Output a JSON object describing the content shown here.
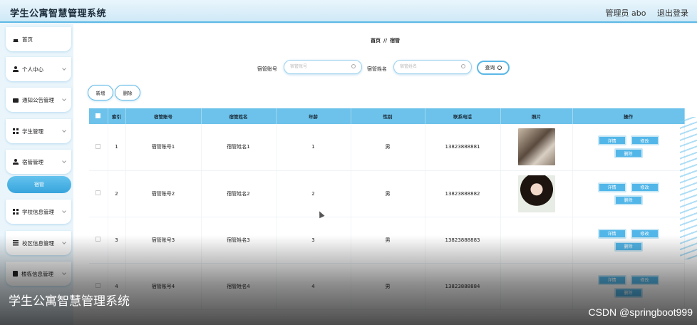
{
  "header": {
    "title": "学生公寓智慧管理系统",
    "user": "管理员 abo",
    "logout": "退出登录"
  },
  "sidebar": {
    "items": [
      {
        "label": "首页",
        "icon": "home-icon"
      },
      {
        "label": "个人中心",
        "icon": "user-icon"
      },
      {
        "label": "通知公告管理",
        "icon": "message-icon"
      },
      {
        "label": "学生管理",
        "icon": "grid-icon"
      },
      {
        "label": "宿管管理",
        "icon": "user-icon"
      },
      {
        "label": "学校信息管理",
        "icon": "grid-icon"
      },
      {
        "label": "校区信息管理",
        "icon": "list-icon"
      },
      {
        "label": "楼栋信息管理",
        "icon": "book-icon"
      }
    ],
    "sub_active": "宿管"
  },
  "breadcrumb": {
    "home": "首页",
    "sep": "//",
    "current": "宿管"
  },
  "search": {
    "account_label": "宿管账号",
    "account_placeholder": "宿管账号",
    "name_label": "宿管姓名",
    "name_placeholder": "宿管姓名",
    "query_label": "查询"
  },
  "actions": {
    "add": "新增",
    "delete": "删除"
  },
  "table": {
    "columns": [
      "索引",
      "宿管账号",
      "宿管姓名",
      "年龄",
      "性别",
      "联系电话",
      "照片",
      "操作"
    ],
    "rows": [
      {
        "index": "1",
        "account": "宿管账号1",
        "name": "宿管姓名1",
        "age": "1",
        "gender": "男",
        "phone": "13823888881"
      },
      {
        "index": "2",
        "account": "宿管账号2",
        "name": "宿管姓名2",
        "age": "2",
        "gender": "男",
        "phone": "13823888882"
      },
      {
        "index": "3",
        "account": "宿管账号3",
        "name": "宿管姓名3",
        "age": "3",
        "gender": "男",
        "phone": "13823888883"
      },
      {
        "index": "4",
        "account": "宿管账号4",
        "name": "宿管姓名4",
        "age": "4",
        "gender": "男",
        "phone": "13823888884"
      }
    ],
    "ops": {
      "detail": "详情",
      "edit": "修改",
      "delete": "删除"
    }
  },
  "overlay": {
    "title": "学生公寓智慧管理系统",
    "watermark": "CSDN @springboot999"
  }
}
